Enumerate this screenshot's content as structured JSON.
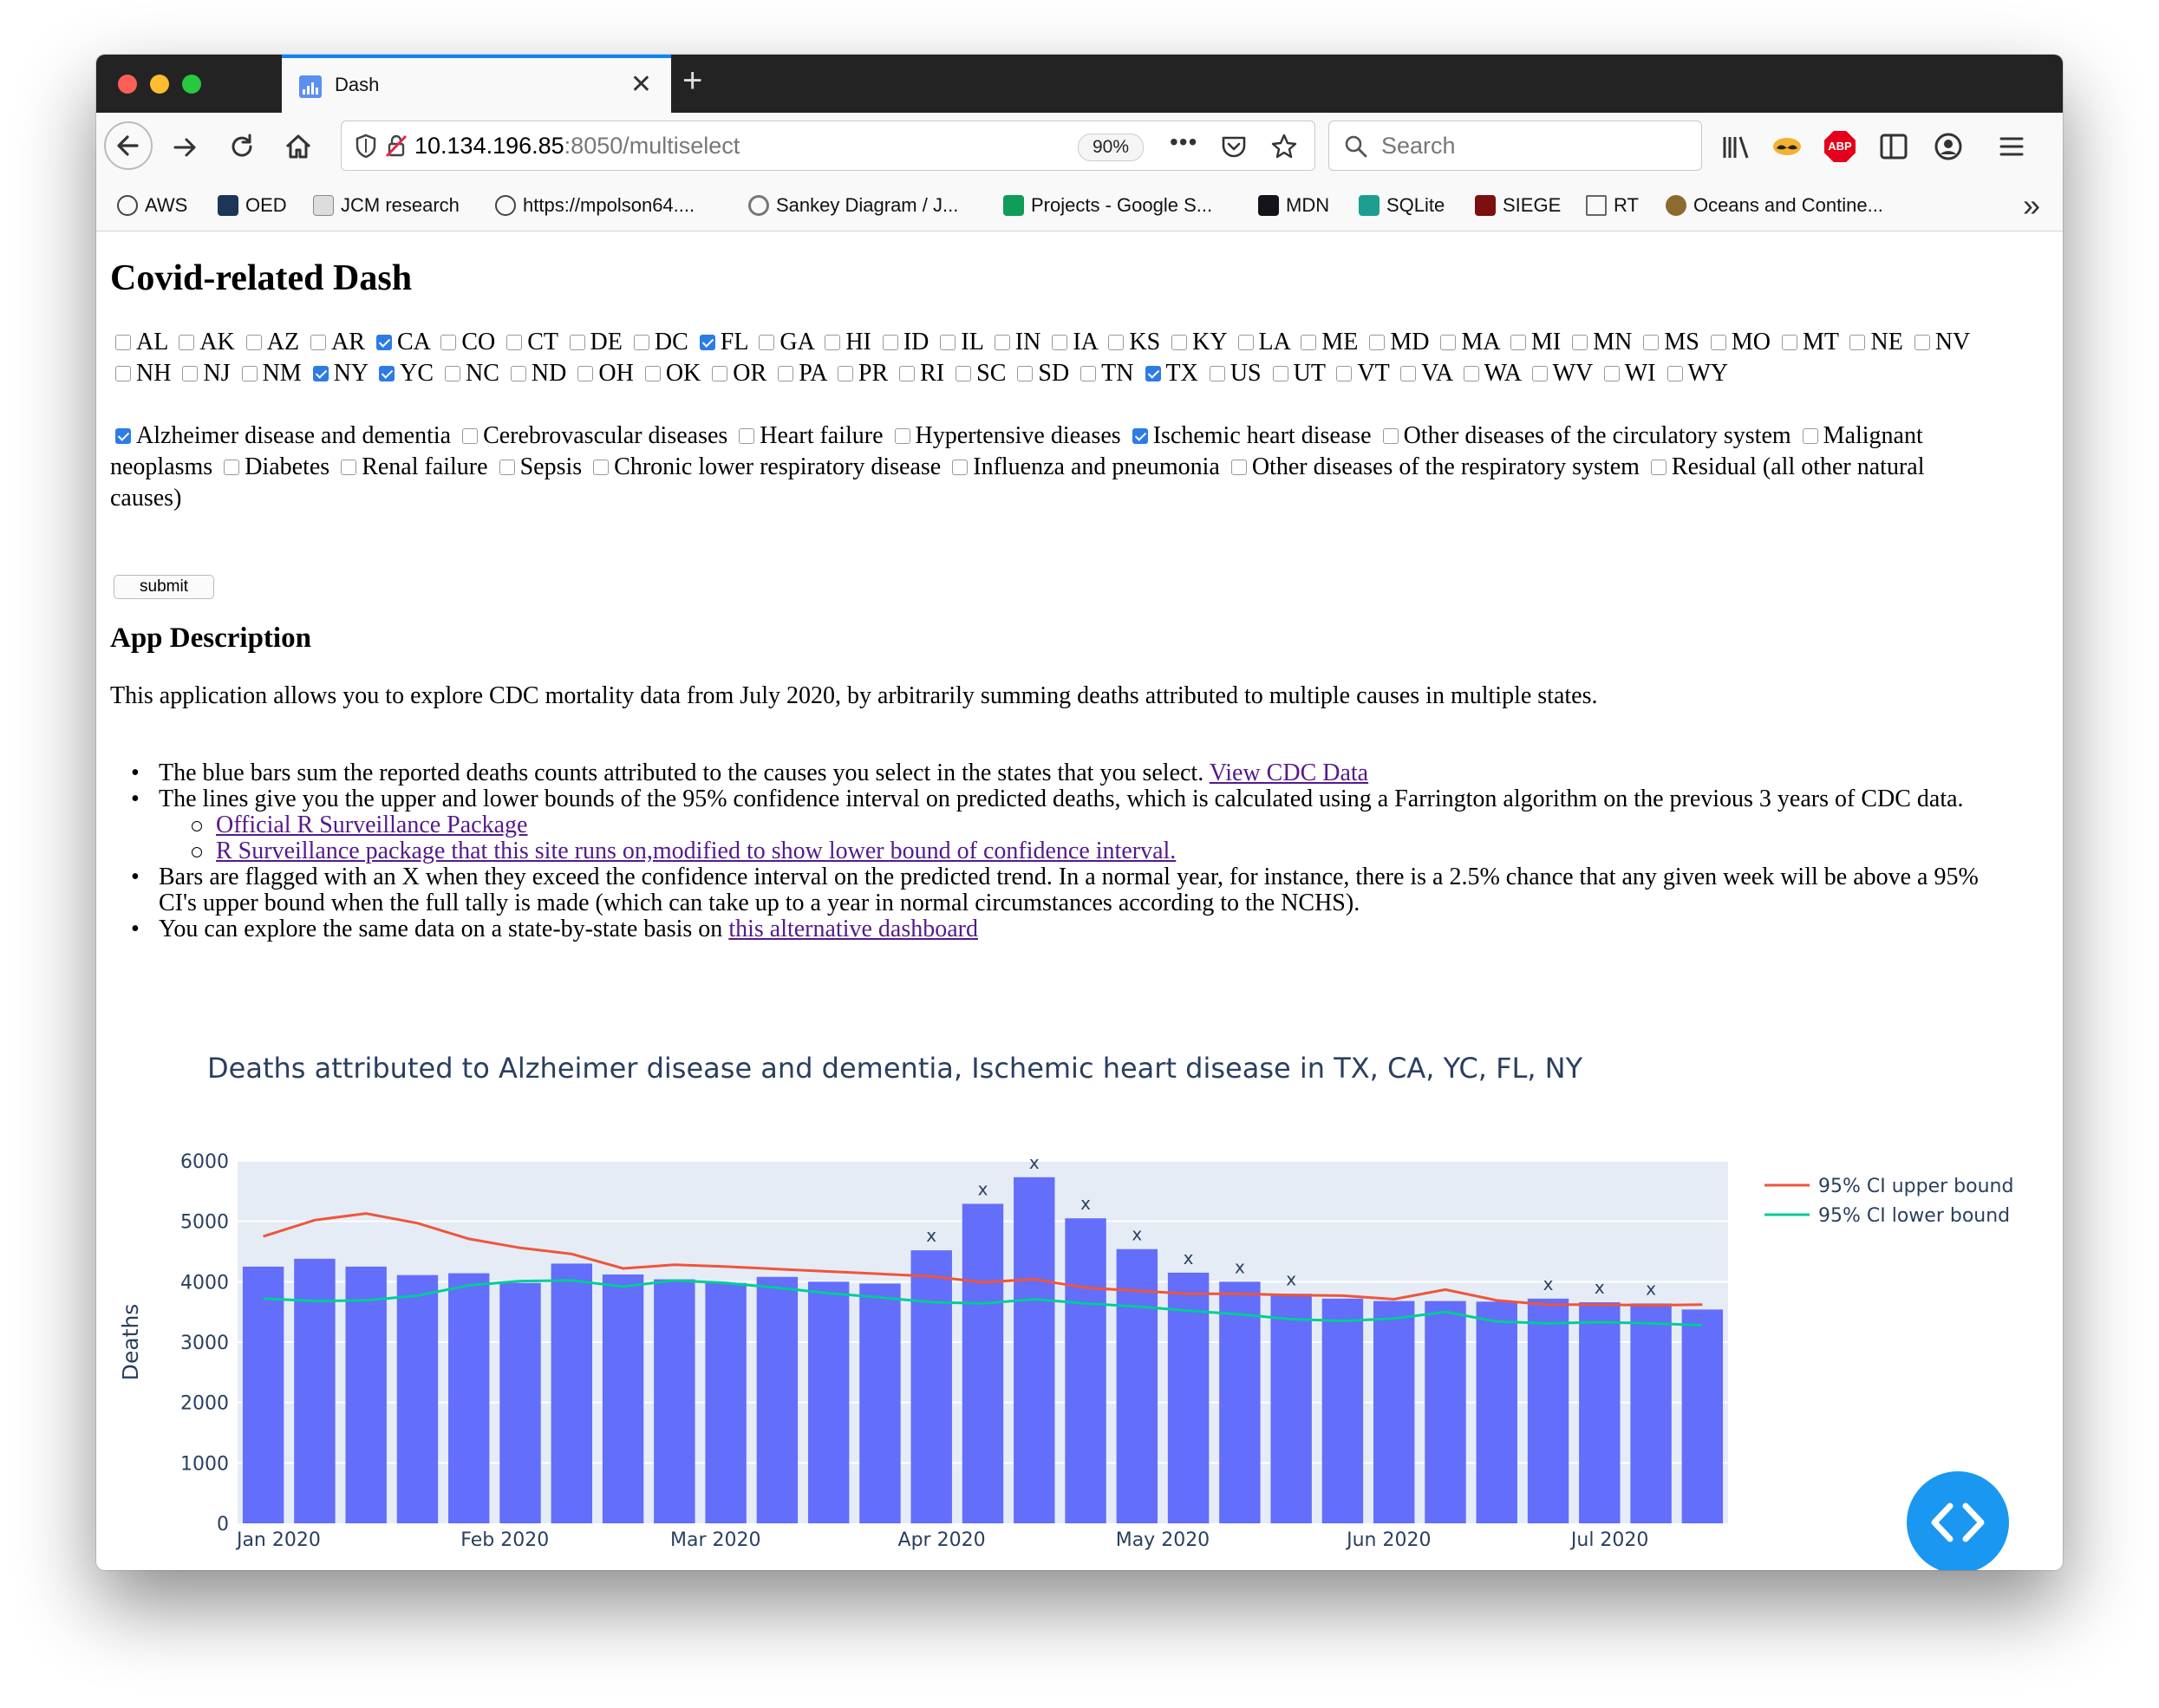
{
  "browser": {
    "tab_title": "Dash",
    "url_host": "10.134.196.85",
    "url_path": ":8050/multiselect",
    "zoom": "90%",
    "search_placeholder": "Search",
    "bookmarks": [
      {
        "label": "AWS",
        "icon": "globe-icon",
        "color": "#444444"
      },
      {
        "label": "OED",
        "icon": "oed-icon",
        "color": "#1d3557"
      },
      {
        "label": "JCM research",
        "icon": "moose-icon",
        "color": "#666666"
      },
      {
        "label": "https://mpolson64....",
        "icon": "globe-icon",
        "color": "#444444"
      },
      {
        "label": "Sankey Diagram / J...",
        "icon": "observable-icon",
        "color": "#777777"
      },
      {
        "label": "Projects - Google S...",
        "icon": "sheets-icon",
        "color": "#0f9d58"
      },
      {
        "label": "MDN",
        "icon": "mdn-icon",
        "color": "#15141a"
      },
      {
        "label": "SQLite",
        "icon": "sqlite-icon",
        "color": "#1e9e8f"
      },
      {
        "label": "SIEGE",
        "icon": "siege-icon",
        "color": "#7a1010"
      },
      {
        "label": "RT",
        "icon": "folder-icon",
        "color": "#666666"
      },
      {
        "label": "Oceans and Contine...",
        "icon": "map-icon",
        "color": "#8b6b2e"
      }
    ]
  },
  "page": {
    "title": "Covid-related Dash",
    "states": [
      {
        "code": "AL",
        "checked": false
      },
      {
        "code": "AK",
        "checked": false
      },
      {
        "code": "AZ",
        "checked": false
      },
      {
        "code": "AR",
        "checked": false
      },
      {
        "code": "CA",
        "checked": true
      },
      {
        "code": "CO",
        "checked": false
      },
      {
        "code": "CT",
        "checked": false
      },
      {
        "code": "DE",
        "checked": false
      },
      {
        "code": "DC",
        "checked": false
      },
      {
        "code": "FL",
        "checked": true
      },
      {
        "code": "GA",
        "checked": false
      },
      {
        "code": "HI",
        "checked": false
      },
      {
        "code": "ID",
        "checked": false
      },
      {
        "code": "IL",
        "checked": false
      },
      {
        "code": "IN",
        "checked": false
      },
      {
        "code": "IA",
        "checked": false
      },
      {
        "code": "KS",
        "checked": false
      },
      {
        "code": "KY",
        "checked": false
      },
      {
        "code": "LA",
        "checked": false
      },
      {
        "code": "ME",
        "checked": false
      },
      {
        "code": "MD",
        "checked": false
      },
      {
        "code": "MA",
        "checked": false
      },
      {
        "code": "MI",
        "checked": false
      },
      {
        "code": "MN",
        "checked": false
      },
      {
        "code": "MS",
        "checked": false
      },
      {
        "code": "MO",
        "checked": false
      },
      {
        "code": "MT",
        "checked": false
      },
      {
        "code": "NE",
        "checked": false
      },
      {
        "code": "NV",
        "checked": false
      },
      {
        "code": "NH",
        "checked": false
      },
      {
        "code": "NJ",
        "checked": false
      },
      {
        "code": "NM",
        "checked": false
      },
      {
        "code": "NY",
        "checked": true
      },
      {
        "code": "YC",
        "checked": true
      },
      {
        "code": "NC",
        "checked": false
      },
      {
        "code": "ND",
        "checked": false
      },
      {
        "code": "OH",
        "checked": false
      },
      {
        "code": "OK",
        "checked": false
      },
      {
        "code": "OR",
        "checked": false
      },
      {
        "code": "PA",
        "checked": false
      },
      {
        "code": "PR",
        "checked": false
      },
      {
        "code": "RI",
        "checked": false
      },
      {
        "code": "SC",
        "checked": false
      },
      {
        "code": "SD",
        "checked": false
      },
      {
        "code": "TN",
        "checked": false
      },
      {
        "code": "TX",
        "checked": true
      },
      {
        "code": "US",
        "checked": false
      },
      {
        "code": "UT",
        "checked": false
      },
      {
        "code": "VT",
        "checked": false
      },
      {
        "code": "VA",
        "checked": false
      },
      {
        "code": "WA",
        "checked": false
      },
      {
        "code": "WV",
        "checked": false
      },
      {
        "code": "WI",
        "checked": false
      },
      {
        "code": "WY",
        "checked": false
      }
    ],
    "causes": [
      {
        "label": "Alzheimer disease and dementia",
        "checked": true
      },
      {
        "label": "Cerebrovascular diseases",
        "checked": false
      },
      {
        "label": "Heart failure",
        "checked": false
      },
      {
        "label": "Hypertensive dieases",
        "checked": false
      },
      {
        "label": "Ischemic heart disease",
        "checked": true
      },
      {
        "label": "Other diseases of the circulatory system",
        "checked": false
      },
      {
        "label": "Malignant neoplasms",
        "checked": false
      },
      {
        "label": "Diabetes",
        "checked": false
      },
      {
        "label": "Renal failure",
        "checked": false
      },
      {
        "label": "Sepsis",
        "checked": false
      },
      {
        "label": "Chronic lower respiratory disease",
        "checked": false
      },
      {
        "label": "Influenza and pneumonia",
        "checked": false
      },
      {
        "label": "Other diseases of the respiratory system",
        "checked": false
      },
      {
        "label": "Residual (all other natural causes)",
        "checked": false
      }
    ],
    "submit_label": "submit",
    "description_heading": "App Description",
    "description": "This application allows you to explore CDC mortality data from July 2020, by arbitrarily summing deaths attributed to multiple causes in multiple states.",
    "bullets": {
      "b1_text": "The blue bars sum the reported deaths counts attributed to the causes you select in the states that you select.",
      "b1_link": "View CDC Data",
      "b2_text": "The lines give you the upper and lower bounds of the 95% confidence interval on predicted deaths, which is calculated using a Farrington algorithm on the previous 3 years of CDC data.",
      "b2_sub1": "Official R Surveillance Package",
      "b2_sub2": "R Surveillance package that this site runs on,modified to show lower bound of confidence interval.",
      "b3_text": "Bars are flagged with an X when they exceed the confidence interval on the predicted trend. In a normal year, for instance, there is a 2.5% chance that any given week will be above a 95% CI's upper bound when the full tally is made (which can take up to a year in normal circumstances according to the NCHS).",
      "b4_text": "You can explore the same data on a state-by-state basis on",
      "b4_link": "this alternative dashboard"
    }
  },
  "chart_data": {
    "type": "bar",
    "title": "Deaths attributed to Alzheimer disease and dementia, Ischemic heart disease in TX, CA, YC, FL, NY",
    "ylabel": "Deaths",
    "xlabel": "",
    "ylim": [
      0,
      6000
    ],
    "yticks": [
      "0",
      "1000",
      "2000",
      "3000",
      "4000",
      "5000",
      "6000"
    ],
    "xticks": [
      {
        "label": "Jan 2020",
        "index": 0.8
      },
      {
        "label": "Feb 2020",
        "index": 5.2
      },
      {
        "label": "Mar 2020",
        "index": 9.3
      },
      {
        "label": "Apr 2020",
        "index": 13.7
      },
      {
        "label": "May 2020",
        "index": 18.0
      },
      {
        "label": "Jun 2020",
        "index": 22.4
      },
      {
        "label": "Jul 2020",
        "index": 26.7
      }
    ],
    "bars": [
      4250,
      4380,
      4250,
      4110,
      4140,
      3980,
      4300,
      4120,
      4040,
      3980,
      4080,
      4000,
      3970,
      4520,
      5290,
      5730,
      5050,
      4540,
      4150,
      4000,
      3800,
      3720,
      3680,
      3680,
      3670,
      3720,
      3660,
      3640,
      3540
    ],
    "flagged": [
      false,
      false,
      false,
      false,
      false,
      false,
      false,
      false,
      false,
      false,
      false,
      false,
      false,
      true,
      true,
      true,
      true,
      true,
      true,
      true,
      true,
      false,
      false,
      false,
      false,
      true,
      true,
      true,
      false
    ],
    "flag_symbol": "x",
    "series": [
      {
        "name": "95% CI upper bound",
        "color": "#ef553b",
        "values": [
          4750,
          5020,
          5130,
          4970,
          4710,
          4560,
          4460,
          4220,
          4280,
          4250,
          4210,
          4170,
          4130,
          4090,
          3990,
          4040,
          3900,
          3850,
          3800,
          3800,
          3780,
          3770,
          3710,
          3870,
          3690,
          3620,
          3620,
          3610,
          3620
        ]
      },
      {
        "name": "95% CI lower bound",
        "color": "#00cc96",
        "values": [
          3720,
          3680,
          3690,
          3770,
          3940,
          4010,
          4020,
          3920,
          4020,
          3980,
          3900,
          3810,
          3740,
          3660,
          3640,
          3710,
          3640,
          3590,
          3520,
          3460,
          3380,
          3350,
          3390,
          3500,
          3340,
          3310,
          3330,
          3310,
          3280
        ]
      }
    ],
    "bar_color": "#636efa",
    "plot_bg": "#e5ecf6",
    "legend_position": "right"
  }
}
